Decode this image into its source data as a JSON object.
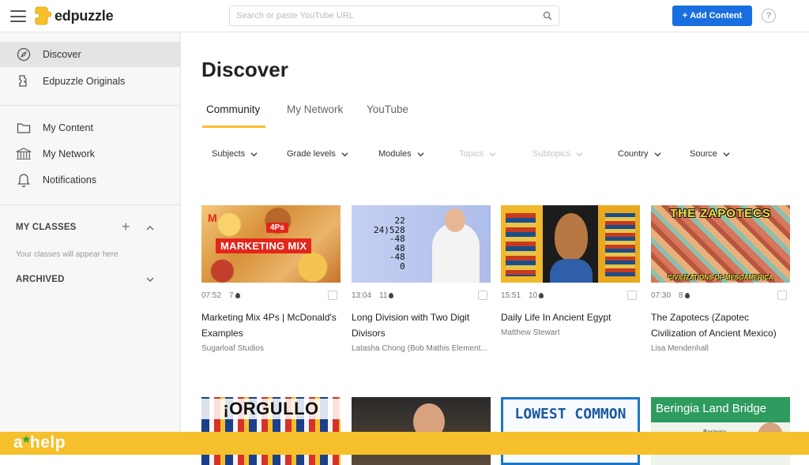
{
  "app": {
    "name": "edpuzzle"
  },
  "search": {
    "placeholder": "Search or paste YouTube URL"
  },
  "header": {
    "add_content_label": "Add Content",
    "help_label": "?"
  },
  "sidebar": {
    "items": [
      {
        "label": "Discover",
        "icon": "compass-icon"
      },
      {
        "label": "Edpuzzle Originals",
        "icon": "puzzle-icon"
      },
      {
        "label": "My Content",
        "icon": "folder-icon"
      },
      {
        "label": "My Network",
        "icon": "network-icon"
      },
      {
        "label": "Notifications",
        "icon": "bell-icon"
      }
    ],
    "my_classes": "MY CLASSES",
    "classes_hint": "Your classes will appear here",
    "archived": "ARCHIVED"
  },
  "main": {
    "title": "Discover",
    "tabs": [
      "Community",
      "My Network",
      "YouTube"
    ],
    "filters": [
      "Subjects",
      "Grade levels",
      "Modules",
      "Topics",
      "Subtopics",
      "Country",
      "Source"
    ]
  },
  "cards": [
    {
      "thumb_text": "MARKETING MIX",
      "duration": "07:52",
      "count": "7",
      "title": "Marketing Mix 4Ps | McDonald's Examples",
      "author": "Sugarloaf Studios"
    },
    {
      "thumb_text": "22\n24)528\n-48\n48\n-48\n0",
      "duration": "13:04",
      "count": "11",
      "title": "Long Division with Two Digit Divisors",
      "author": "Latasha Chong (Bob Mathis Element..."
    },
    {
      "thumb_text": "",
      "duration": "15:51",
      "count": "10",
      "title": "Daily Life In Ancient Egypt",
      "author": "Matthew Stewart"
    },
    {
      "thumb_text": "THE ZAPOTECS",
      "thumb_sub": "CIVILIZATIONS OF MESOAMERICA",
      "duration": "07:30",
      "count": "8",
      "title": "The Zapotecs (Zapotec Civilization of Ancient Mexico)",
      "author": "Lisa Mendenhall"
    }
  ],
  "cards_row2": [
    {
      "thumb_text": "¡ORGULLO"
    },
    {
      "thumb_text": ""
    },
    {
      "thumb_text": "LOWEST COMMON"
    },
    {
      "thumb_text": "Beringia Land Bridge",
      "thumb_sub": "Beringia"
    }
  ],
  "footer": {
    "brand_a": "a",
    "brand_star": "*",
    "brand_rest": "help"
  },
  "colors": {
    "accent": "#f6c02c",
    "button": "#1a6fe0"
  }
}
